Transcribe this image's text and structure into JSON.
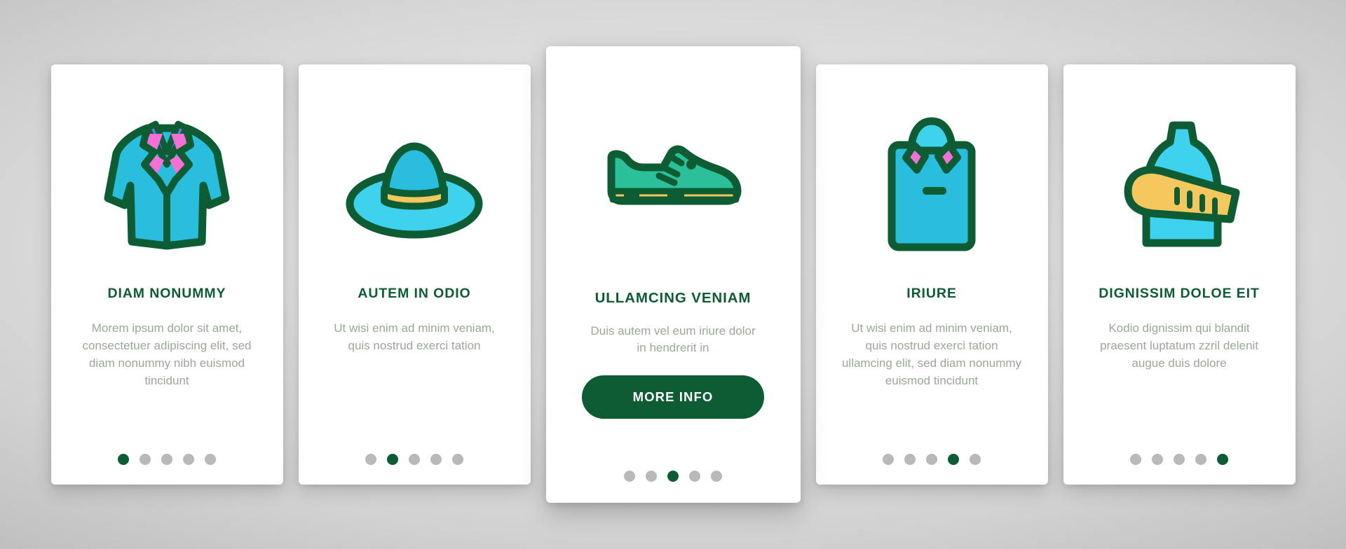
{
  "theme": {
    "brand_green": "#0d5c34",
    "body_text": "#9aa897",
    "dot_inactive": "#b9b9b9",
    "card_bg": "#ffffff",
    "background": "#dcdcdc",
    "icon_cyan": "#29bede",
    "icon_light_cyan": "#3fd2ef",
    "icon_teal": "#2bbf9a",
    "icon_pink": "#f470d6",
    "icon_blue": "#5b7ee8",
    "icon_yellow": "#f4c85c",
    "icon_outline": "#0d5c34"
  },
  "cards": [
    {
      "id": "card-1",
      "icon_name": "blazer-jacket-icon",
      "title": "DIAM NONUMMY",
      "description": "Morem ipsum dolor sit amet, consectetuer adipiscing elit, sed diam nonummy nibh euismod tincidunt",
      "featured": false,
      "dots": 5,
      "active_dot": 1,
      "button": null
    },
    {
      "id": "card-2",
      "icon_name": "sun-hat-icon",
      "title": "AUTEM IN ODIO",
      "description": "Ut wisi enim ad minim veniam, quis nostrud exerci tation",
      "featured": false,
      "dots": 5,
      "active_dot": 2,
      "button": null
    },
    {
      "id": "card-3",
      "icon_name": "sneaker-shoe-icon",
      "title": "ULLAMCING VENIAM",
      "description": "Duis autem vel eum iriure dolor in hendrerit in",
      "featured": true,
      "dots": 5,
      "active_dot": 3,
      "button": "MORE INFO"
    },
    {
      "id": "card-4",
      "icon_name": "folded-shirt-icon",
      "title": "IRIURE",
      "description": "Ut wisi enim ad minim veniam, quis nostrud exerci tation ullamcing elit, sed diam nonummy euismod tincidunt",
      "featured": false,
      "dots": 5,
      "active_dot": 4,
      "button": null
    },
    {
      "id": "card-5",
      "icon_name": "mannequin-measuring-tape-icon",
      "title": "DIGNISSIM DOLOE EIT",
      "description": "Kodio dignissim qui blandit praesent luptatum zzril delenit augue duis dolore",
      "featured": false,
      "dots": 5,
      "active_dot": 5,
      "button": null
    }
  ]
}
